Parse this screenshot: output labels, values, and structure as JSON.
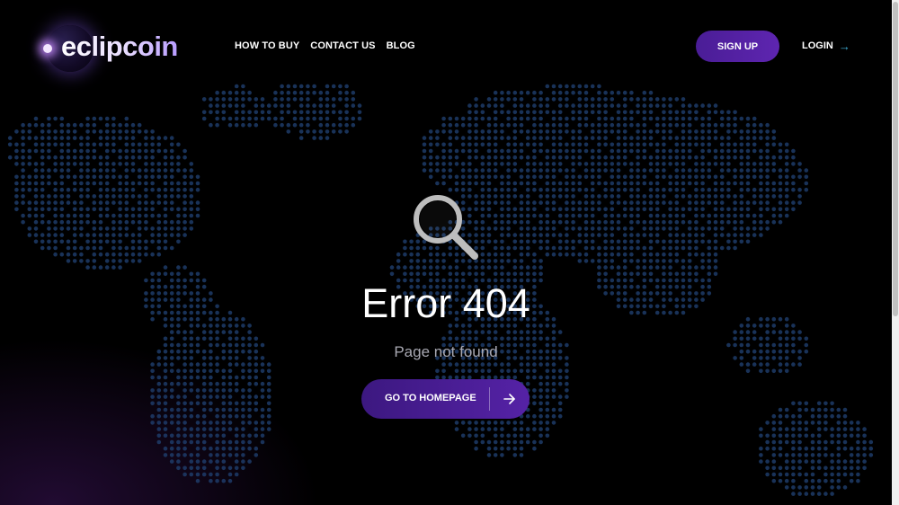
{
  "brand": {
    "name": "eclipcoin"
  },
  "nav": {
    "items": [
      "HOW TO BUY",
      "CONTACT US",
      "BLOG"
    ]
  },
  "auth": {
    "signup_label": "SIGN UP",
    "login_label": "LOGIN",
    "login_arrow": "→"
  },
  "error": {
    "title": "Error 404",
    "subtitle": "Page not found",
    "button_label": "GO TO HOMEPAGE",
    "icon": "search-icon"
  },
  "colors": {
    "background": "#000000",
    "map_dot": "#1f3f6e",
    "accent_purple": "#5522a6",
    "login_arrow": "#3fb0d8",
    "subtitle": "#a9a9b3"
  }
}
